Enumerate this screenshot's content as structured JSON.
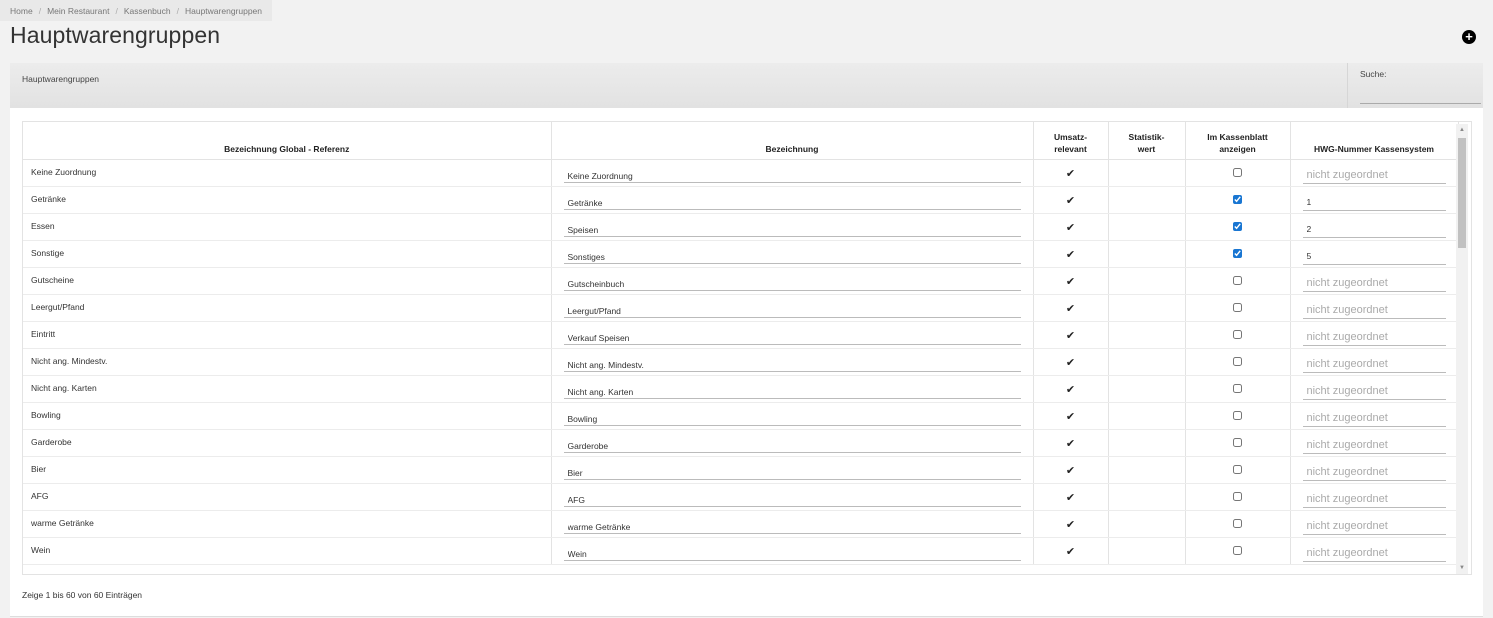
{
  "breadcrumb": [
    "Home",
    "Mein Restaurant",
    "Kassenbuch",
    "Hauptwarengruppen"
  ],
  "page_title": "Hauptwarengruppen",
  "add_button": "+",
  "panel": {
    "label": "Hauptwarengruppen",
    "search_label": "Suche:"
  },
  "table": {
    "headers": {
      "ref": "Bezeichnung Global - Referenz",
      "bez": "Bezeichnung",
      "umsatz": "Umsatz-\nrelevant",
      "statistik": "Statistik-\nwert",
      "kassenblatt": "Im Kassenblatt\nanzeigen",
      "hwg": "HWG-Nummer Kassensystem"
    },
    "placeholder": "nicht zugeordnet",
    "rows": [
      {
        "ref": "Keine Zuordnung",
        "bez": "Keine Zuordnung",
        "umsatz": true,
        "kassenblatt": false,
        "hwg": ""
      },
      {
        "ref": "Getränke",
        "bez": "Getränke",
        "umsatz": true,
        "kassenblatt": true,
        "hwg": "1"
      },
      {
        "ref": "Essen",
        "bez": "Speisen",
        "umsatz": true,
        "kassenblatt": true,
        "hwg": "2"
      },
      {
        "ref": "Sonstige",
        "bez": "Sonstiges",
        "umsatz": true,
        "kassenblatt": true,
        "hwg": "5"
      },
      {
        "ref": "Gutscheine",
        "bez": "Gutscheinbuch",
        "umsatz": true,
        "kassenblatt": false,
        "hwg": ""
      },
      {
        "ref": "Leergut/Pfand",
        "bez": "Leergut/Pfand",
        "umsatz": true,
        "kassenblatt": false,
        "hwg": ""
      },
      {
        "ref": "Eintritt",
        "bez": "Verkauf Speisen",
        "umsatz": true,
        "kassenblatt": false,
        "hwg": ""
      },
      {
        "ref": "Nicht ang. Mindestv.",
        "bez": "Nicht ang. Mindestv.",
        "umsatz": true,
        "kassenblatt": false,
        "hwg": ""
      },
      {
        "ref": "Nicht ang. Karten",
        "bez": "Nicht ang. Karten",
        "umsatz": true,
        "kassenblatt": false,
        "hwg": ""
      },
      {
        "ref": "Bowling",
        "bez": "Bowling",
        "umsatz": true,
        "kassenblatt": false,
        "hwg": ""
      },
      {
        "ref": "Garderobe",
        "bez": "Garderobe",
        "umsatz": true,
        "kassenblatt": false,
        "hwg": ""
      },
      {
        "ref": "Bier",
        "bez": "Bier",
        "umsatz": true,
        "kassenblatt": false,
        "hwg": ""
      },
      {
        "ref": "AFG",
        "bez": "AFG",
        "umsatz": true,
        "kassenblatt": false,
        "hwg": ""
      },
      {
        "ref": "warme Getränke",
        "bez": "warme Getränke",
        "umsatz": true,
        "kassenblatt": false,
        "hwg": ""
      },
      {
        "ref": "Wein",
        "bez": "Wein",
        "umsatz": true,
        "kassenblatt": false,
        "hwg": ""
      }
    ]
  },
  "footer": {
    "info": "Zeige 1 bis 60 von 60 Einträgen"
  },
  "icons": {
    "add": "plus-circle-icon",
    "check": "check-icon",
    "scroll_up": "arrow-up-icon",
    "scroll_down": "arrow-down-icon"
  }
}
